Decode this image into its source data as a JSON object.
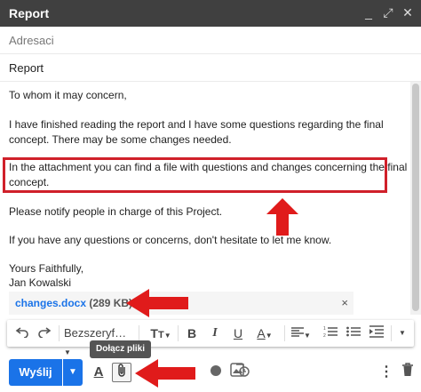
{
  "window": {
    "title": "Report",
    "minimize_glyph": "_",
    "expand_glyph": "⤢",
    "close_glyph": "✕"
  },
  "compose": {
    "to_placeholder": "Adresaci",
    "subject": "Report"
  },
  "body": {
    "greeting": "To whom it may concern,",
    "line1": "I have finished reading the report and I have some questions regarding the final",
    "line2": "concept. There may be some changes needed.",
    "attach_line1": "In the attachment you can find a file with questions and changes concerning the final",
    "attach_line2": "concept.",
    "notify": "Please notify people in charge of this Project.",
    "questions": "If you have any questions or concerns, don't hesitate to let me know.",
    "closing": "Yours Faithfully,",
    "signature": "Jan Kowalski"
  },
  "attachment": {
    "filename": "changes.docx",
    "size": "(289 KB)",
    "remove_glyph": "×"
  },
  "formatting": {
    "font": "Bezszeryf…",
    "size_glyph": "T",
    "bold": "B",
    "italic": "I",
    "underline": "U",
    "text_color": "A"
  },
  "tooltip": {
    "text": "Dołącz pliki"
  },
  "bottom": {
    "send_label": "Wyślij",
    "format_glyph": "A"
  },
  "colors": {
    "accent": "#1a73e8",
    "highlight": "#d0202a",
    "titlebar": "#404040"
  },
  "icons": [
    "undo-icon",
    "redo-icon",
    "font-size-icon",
    "align-icon",
    "numbered-list-icon",
    "bulleted-list-icon",
    "indent-icon",
    "more-icon",
    "format-icon",
    "attach-icon",
    "drive-icon",
    "schedule-icon",
    "trash-icon"
  ]
}
